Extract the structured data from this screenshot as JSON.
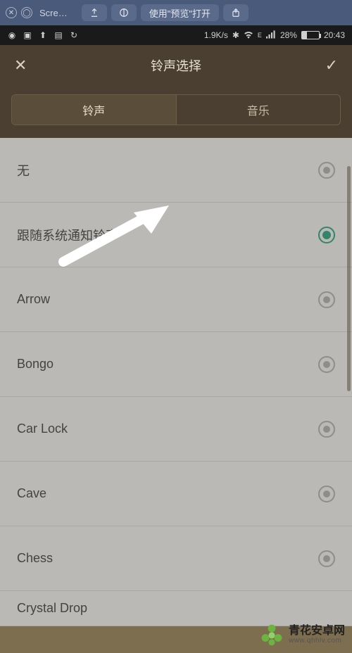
{
  "browser": {
    "title": "Scre…",
    "preview_btn": "使用\"预览\"打开"
  },
  "status": {
    "speed": "1.9K/s",
    "signal": "E",
    "battery_pct": "28%",
    "time": "20:43"
  },
  "header": {
    "title": "铃声选择"
  },
  "tabs": {
    "ringtone": "铃声",
    "music": "音乐"
  },
  "ringtones": [
    {
      "label": "无",
      "selected": false
    },
    {
      "label": "跟随系统通知铃声",
      "selected": true
    },
    {
      "label": "Arrow",
      "selected": false
    },
    {
      "label": "Bongo",
      "selected": false
    },
    {
      "label": "Car Lock",
      "selected": false
    },
    {
      "label": "Cave",
      "selected": false
    },
    {
      "label": "Chess",
      "selected": false
    },
    {
      "label": "Crystal Drop",
      "selected": false
    }
  ],
  "watermark": {
    "cn": "青花安卓网",
    "url": "www.qhhlv.com"
  }
}
